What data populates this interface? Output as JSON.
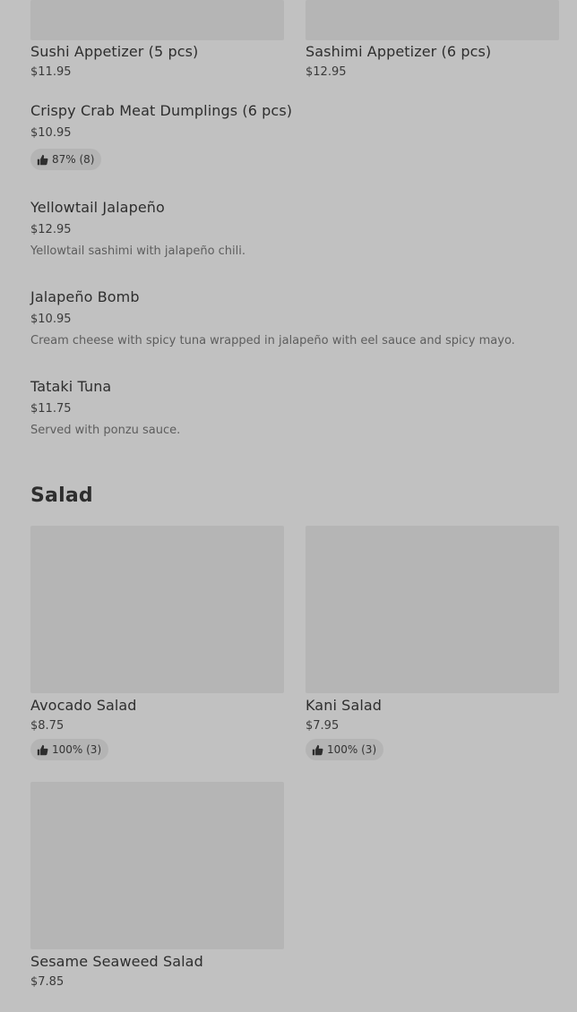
{
  "colors": {
    "background": "#c1c1c1",
    "image_placeholder": "#b5b5b5",
    "text_primary": "#2e2e2e",
    "text_secondary": "#5d5d5d"
  },
  "items_top_grid": [
    {
      "name": "Sushi Appetizer (5 pcs)",
      "price": "$11.95"
    },
    {
      "name": "Sashimi Appetizer (6 pcs)",
      "price": "$12.95"
    }
  ],
  "items_list": [
    {
      "name": "Crispy Crab Meat Dumplings (6 pcs)",
      "price": "$10.95",
      "rating": "87% (8)",
      "icon": "thumbs-up-icon"
    },
    {
      "name": "Yellowtail Jalapeño",
      "price": "$12.95",
      "description": "Yellowtail sashimi with jalapeño chili."
    },
    {
      "name": "Jalapeño Bomb",
      "price": "$10.95",
      "description": "Cream cheese with spicy tuna wrapped in jalapeño with eel sauce and spicy mayo."
    },
    {
      "name": "Tataki Tuna",
      "price": "$11.75",
      "description": "Served with ponzu sauce."
    }
  ],
  "salad_section": {
    "title": "Salad",
    "items": [
      {
        "name": "Avocado Salad",
        "price": "$8.75",
        "rating": "100% (3)",
        "icon": "thumbs-up-icon"
      },
      {
        "name": "Kani Salad",
        "price": "$7.95",
        "rating": "100% (3)",
        "icon": "thumbs-up-icon"
      },
      {
        "name": "Sesame Seaweed Salad",
        "price": "$7.85"
      }
    ]
  }
}
